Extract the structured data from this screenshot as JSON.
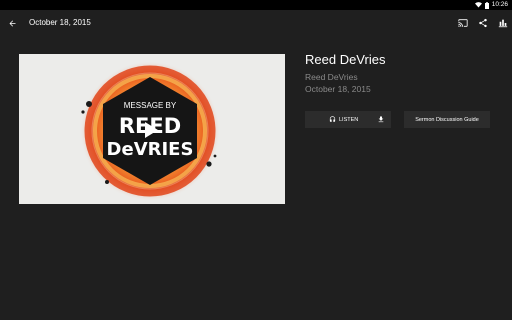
{
  "status_bar": {
    "time": "10:26"
  },
  "app_bar": {
    "title": "October 18, 2015",
    "icons": [
      "arrow-back-icon",
      "cast-icon",
      "share-icon",
      "bar-chart-icon"
    ]
  },
  "media": {
    "thumbnail_line1": "MESSAGE BY",
    "thumbnail_line2": "REED",
    "thumbnail_line3": "DeVRIES"
  },
  "detail": {
    "title": "Reed DeVries",
    "speaker": "Reed DeVries",
    "date": "October 18, 2015"
  },
  "buttons": {
    "listen_label": "LISTEN",
    "guide_label": "Sermon Discussion Guide"
  },
  "colors": {
    "background": "#1f1f1f",
    "status_bar": "#000000",
    "button_bg": "#2c2c2c",
    "secondary_text": "#8a8a8a",
    "accent_orange": "#f07b2a"
  }
}
